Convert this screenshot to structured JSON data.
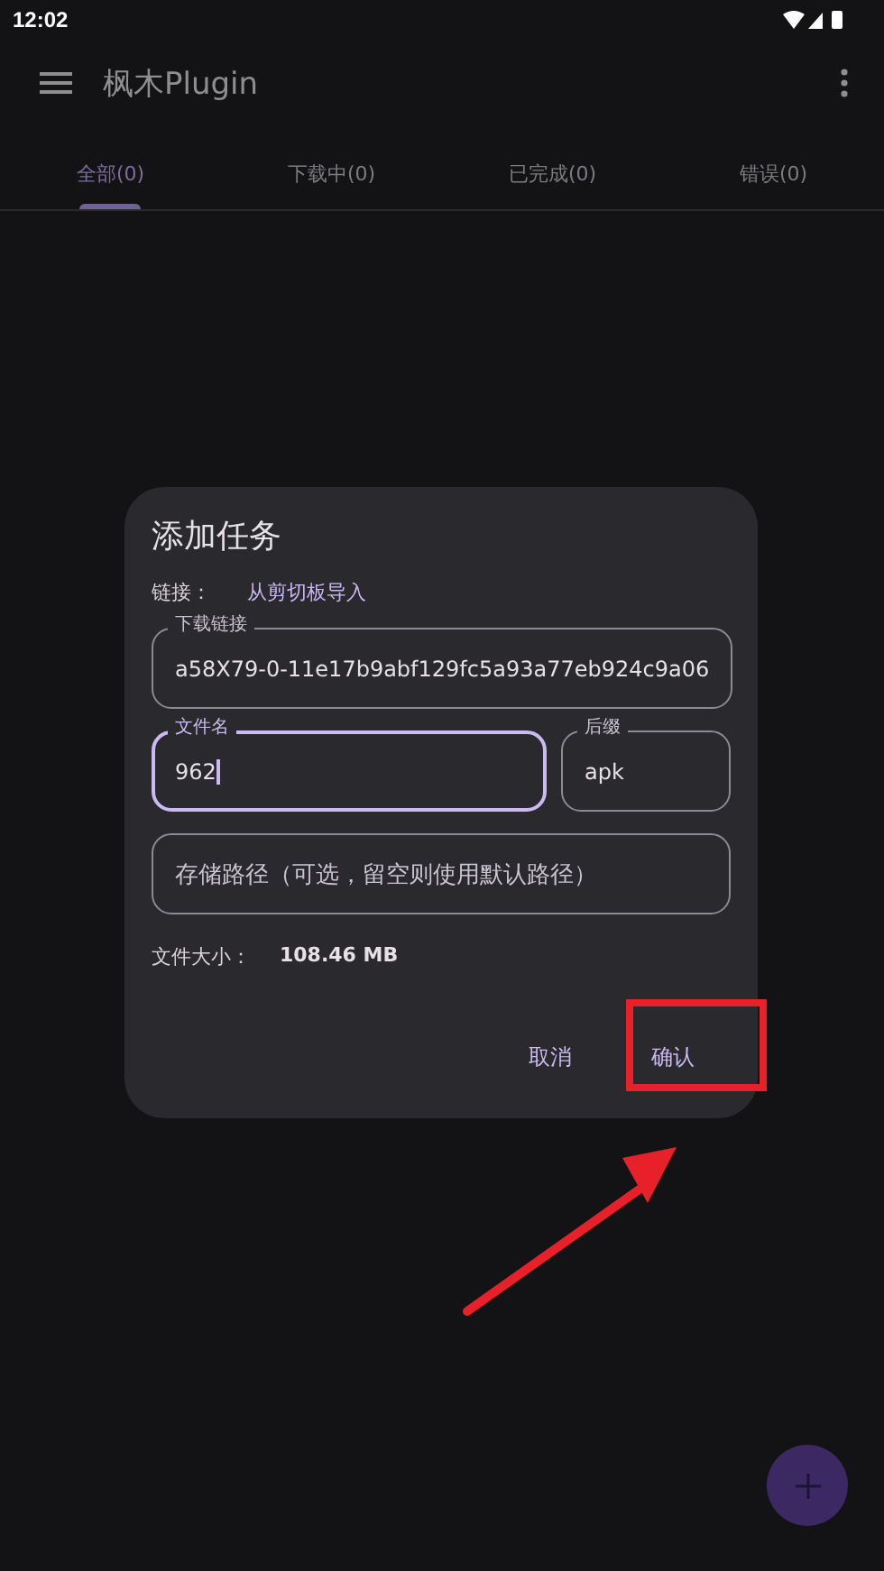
{
  "status_bar": {
    "time": "12:02"
  },
  "app_bar": {
    "title": "枫木Plugin"
  },
  "tabs": [
    {
      "label": "全部(0)",
      "selected": true
    },
    {
      "label": "下载中(0)",
      "selected": false
    },
    {
      "label": "已完成(0)",
      "selected": false
    },
    {
      "label": "错误(0)",
      "selected": false
    }
  ],
  "dialog": {
    "title": "添加任务",
    "link_row": {
      "label": "链接：",
      "action": "从剪切板导入"
    },
    "fields": [
      {
        "label": "下载链接",
        "value": "a58X79-0-11e17b9abf129fc5a93a77eb924c9a06",
        "focused": false
      },
      {
        "label": "文件名",
        "value": "962",
        "focused": true
      },
      {
        "label": "后缀",
        "value": "apk",
        "focused": false
      },
      {
        "placeholder": "存储路径（可选，留空则使用默认路径）",
        "focused": false
      }
    ],
    "size": {
      "label": "文件大小：",
      "value": "108.46 MB"
    },
    "buttons": [
      {
        "label": "取消",
        "highlighted": false
      },
      {
        "label": "确认",
        "highlighted": true
      }
    ]
  }
}
